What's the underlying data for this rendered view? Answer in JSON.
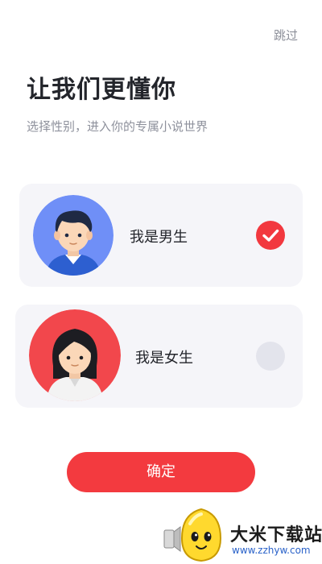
{
  "header": {
    "skip_label": "跳过",
    "title": "让我们更懂你",
    "subtitle": "选择性别，进入你的专属小说世界"
  },
  "options": [
    {
      "label": "我是男生",
      "selected": true,
      "avatar_icon": "male-avatar-icon",
      "avatar_bg": "#6f8ff7"
    },
    {
      "label": "我是女生",
      "selected": false,
      "avatar_icon": "female-avatar-icon",
      "avatar_bg": "#f2474c"
    }
  ],
  "confirm_label": "确定",
  "watermark": {
    "name": "大米下载站",
    "url": "www.zzhyw.com"
  },
  "colors": {
    "accent": "#f33a3f",
    "card_bg": "#f5f5f9",
    "unselected_radio": "#e3e4ec"
  }
}
